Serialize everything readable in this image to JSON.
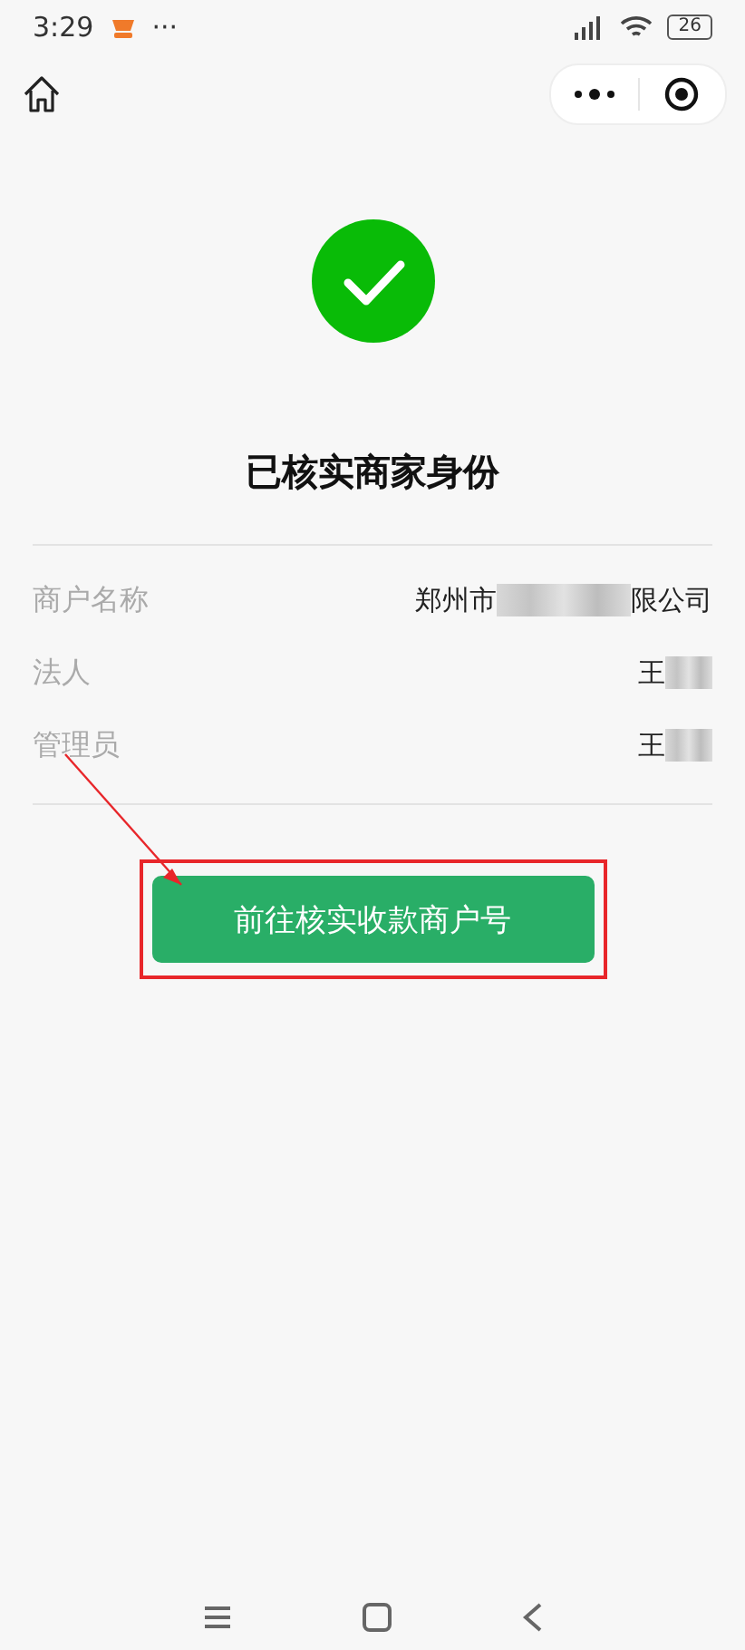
{
  "status_bar": {
    "time": "3:29",
    "more": "···",
    "battery": "26"
  },
  "title": "已核实商家身份",
  "fields": [
    {
      "label": "商户名称",
      "value_start": "郑州市",
      "value_end": "限公司"
    },
    {
      "label": "法人",
      "value_start": "王"
    },
    {
      "label": "管理员",
      "value_start": "王"
    }
  ],
  "action_button": "前往核实收款商户号"
}
